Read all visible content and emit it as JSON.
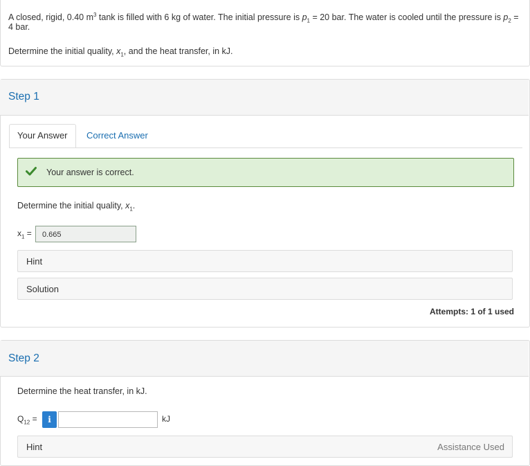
{
  "problem": {
    "line1_a": "A closed, rigid, 0.40 m",
    "line1_sup": "3",
    "line1_b": " tank is filled with 6 kg of water.  The initial pressure is ",
    "p1_var": "p",
    "p1_sub": "1",
    "p1_eq": " = 20 bar.  The water is cooled until the pressure is ",
    "p2_var": "p",
    "p2_sub": "2",
    "p2_eq": " =",
    "line2": "4 bar.",
    "line3_a": "Determine the initial quality, ",
    "x_var": "x",
    "x_sub": "1",
    "line3_b": ", and the heat transfer, in kJ."
  },
  "step1": {
    "title": "Step 1",
    "tabs": [
      "Your Answer",
      "Correct Answer"
    ],
    "success_text": "Your answer is correct.",
    "question_a": "Determine the initial quality, ",
    "question_var": "x",
    "question_sub": "1",
    "question_b": ".",
    "answer_label_var": "x",
    "answer_label_sub": "1",
    "answer_label_eq": " =",
    "answer_value": "0.665",
    "hint_label": "Hint",
    "solution_label": "Solution",
    "attempts": "Attempts: 1 of 1 used"
  },
  "step2": {
    "title": "Step 2",
    "question": "Determine the heat transfer, in kJ.",
    "answer_label_var": "Q",
    "answer_label_sub": "12",
    "answer_label_eq": " =",
    "info_icon": "i",
    "answer_value": "",
    "unit": "kJ",
    "hint_label": "Hint",
    "assistance": "Assistance Used"
  },
  "colors": {
    "link": "#1a6eb0",
    "success_bg": "#dff0d8",
    "success_border": "#5a8a3c",
    "check": "#3c8a2e",
    "info_button": "#2a7fcf"
  },
  "icons": {
    "success": "check-icon",
    "info": "info-icon"
  }
}
